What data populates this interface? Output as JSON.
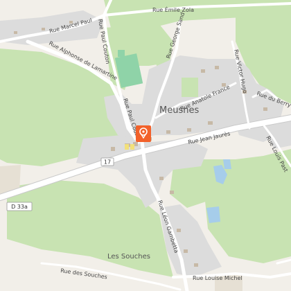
{
  "map": {
    "town": "Meusnes",
    "hamlet": "Les Souches",
    "road_refs": {
      "route_17": "17",
      "d33a": "D 33a"
    },
    "streets": {
      "emile_zola": "Rue Émile Zola",
      "marcel_paul": "Rue Marcel Paul",
      "paul_couton_n": "Rue Paul Couton",
      "paul_couton_s": "Rue Paul Couton",
      "alphonse": "Rue Alphonse de Lamartine",
      "george_sand": "Rue George Sand",
      "victor_hugo": "Rue Victor Hugo",
      "anatole_france": "Rue Anatole France",
      "du_berry": "Rue du Berry",
      "louis_pasteur": "Rue Louis Past",
      "jean_jaures": "Rue Jean Jaurès",
      "leon_gambetta": "Rue Léon Gambetta",
      "des_souches": "Rue des Souches",
      "louise_michel": "Rue Louise Michel"
    },
    "colors": {
      "background": "#f2efe9",
      "forest": "#c8e3b2",
      "built": "#dcdcdc",
      "water": "#a6cdea",
      "pitch": "#8fd3a8",
      "marker": "#f2612a",
      "road": "#ffffff"
    },
    "marker_icon": "location-pin-icon"
  }
}
